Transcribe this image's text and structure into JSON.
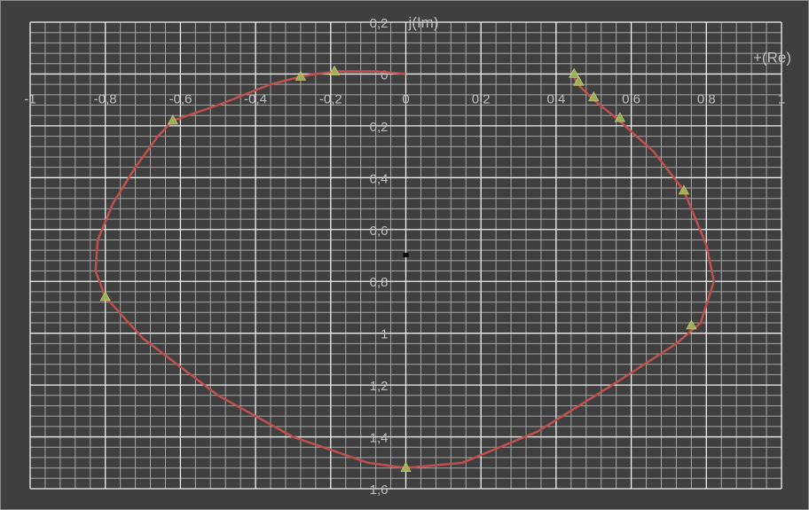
{
  "chart_data": {
    "type": "scatter",
    "title": "",
    "xlabel": "+(Re)",
    "ylabel": "j(Im)",
    "xlim": [
      -1,
      1
    ],
    "ylim": [
      -1.6,
      0.2
    ],
    "grid": true,
    "x_ticks": [
      {
        "value": -1,
        "label": "-1"
      },
      {
        "value": -0.8,
        "label": "-0,8"
      },
      {
        "value": -0.6,
        "label": "-0,6"
      },
      {
        "value": -0.4,
        "label": "-0,4"
      },
      {
        "value": -0.2,
        "label": "-0,2"
      },
      {
        "value": 0,
        "label": "0"
      },
      {
        "value": 0.2,
        "label": "0,2"
      },
      {
        "value": 0.4,
        "label": "0,4"
      },
      {
        "value": 0.6,
        "label": "0,6"
      },
      {
        "value": 0.8,
        "label": "0,8"
      },
      {
        "value": 1,
        "label": "1"
      }
    ],
    "y_ticks": [
      {
        "value": 0.2,
        "label": "0,2"
      },
      {
        "value": 0,
        "label": "0"
      },
      {
        "value": -0.2,
        "label": "0,2"
      },
      {
        "value": -0.4,
        "label": "0,4"
      },
      {
        "value": -0.6,
        "label": "0,6"
      },
      {
        "value": -0.8,
        "label": "0,8"
      },
      {
        "value": -1,
        "label": "1"
      },
      {
        "value": -1.2,
        "label": "1,2"
      },
      {
        "value": -1.4,
        "label": "1,4"
      },
      {
        "value": -1.6,
        "label": "1,6"
      }
    ],
    "series": [
      {
        "color": "#c0504d",
        "marker": "none",
        "points": [
          [
            0.0,
            0.0
          ],
          [
            -0.08,
            0.01
          ],
          [
            -0.18,
            0.01
          ],
          [
            -0.24,
            0.0
          ],
          [
            -0.28,
            -0.01
          ],
          [
            -0.36,
            -0.04
          ],
          [
            -0.5,
            -0.12
          ],
          [
            -0.62,
            -0.18
          ],
          [
            -0.66,
            -0.24
          ],
          [
            -0.72,
            -0.36
          ],
          [
            -0.78,
            -0.5
          ],
          [
            -0.82,
            -0.64
          ],
          [
            -0.826,
            -0.76
          ],
          [
            -0.8,
            -0.86
          ],
          [
            -0.7,
            -1.02
          ],
          [
            -0.5,
            -1.24
          ],
          [
            -0.3,
            -1.4
          ],
          [
            -0.1,
            -1.5
          ],
          [
            0.0,
            -1.52
          ],
          [
            0.15,
            -1.5
          ],
          [
            0.35,
            -1.38
          ],
          [
            0.55,
            -1.2
          ],
          [
            0.72,
            -1.04
          ],
          [
            0.785,
            -0.96
          ],
          [
            0.82,
            -0.8
          ],
          [
            0.8,
            -0.66
          ],
          [
            0.74,
            -0.45
          ],
          [
            0.66,
            -0.3
          ],
          [
            0.56,
            -0.17
          ],
          [
            0.5,
            -0.1
          ],
          [
            0.465,
            -0.05
          ],
          [
            0.45,
            -0.02
          ],
          [
            0.448,
            0.0
          ]
        ]
      },
      {
        "color": "#9bbb59",
        "marker": "triangle",
        "points": [
          [
            -0.19,
            0.01
          ],
          [
            -0.28,
            -0.01
          ],
          [
            -0.62,
            -0.18
          ],
          [
            -0.8,
            -0.86
          ],
          [
            0.0,
            -1.52
          ],
          [
            0.76,
            -0.97
          ],
          [
            0.74,
            -0.45
          ],
          [
            0.57,
            -0.17
          ],
          [
            0.5,
            -0.09
          ],
          [
            0.46,
            -0.03
          ],
          [
            0.448,
            0.0
          ]
        ]
      }
    ],
    "annotations": [
      {
        "x": 0.0,
        "y": -0.7,
        "marker": "square",
        "color": "#000000"
      }
    ]
  }
}
